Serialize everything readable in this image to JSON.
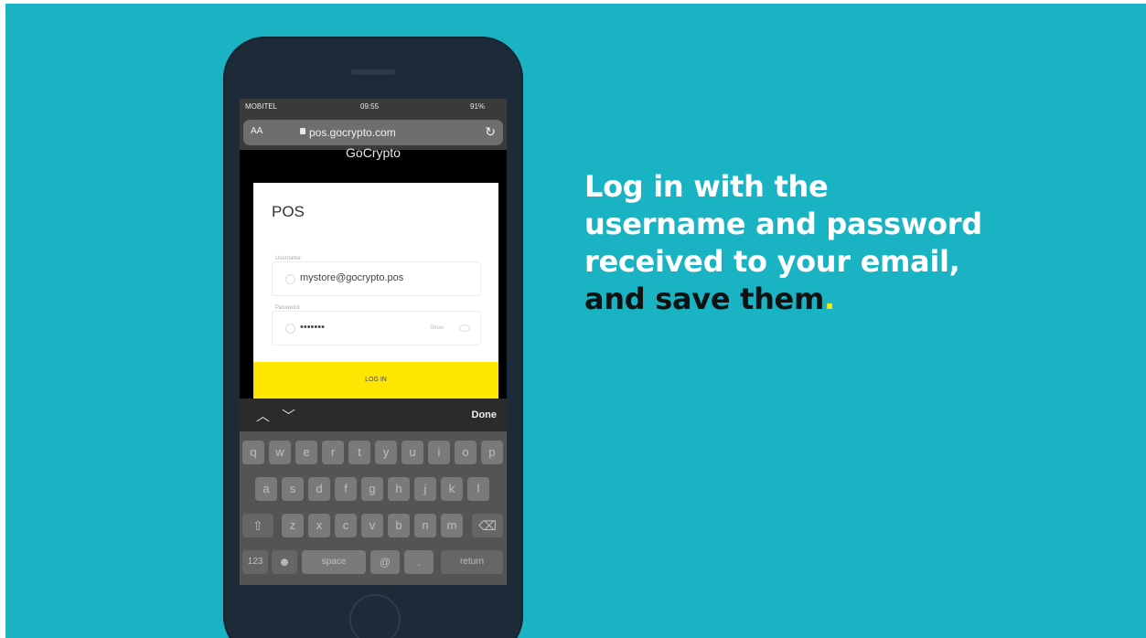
{
  "status_bar": {
    "carrier": "MOBITEL",
    "time": "09:55",
    "battery": "91%"
  },
  "browser": {
    "text_size": "AA",
    "url": "pos.gocrypto.com",
    "reload_icon": "reload-icon"
  },
  "app": {
    "brand": "GoCrypto",
    "card_title": "POS",
    "username": {
      "label": "Username",
      "value": "mystore@gocrypto.pos"
    },
    "password": {
      "label": "Password",
      "value": "•••••••",
      "show_label": "Show"
    },
    "login_label": "LOG IN"
  },
  "keyboard": {
    "toolbar": {
      "done": "Done"
    },
    "row1": [
      "q",
      "w",
      "e",
      "r",
      "t",
      "y",
      "u",
      "i",
      "o",
      "p"
    ],
    "row2": [
      "a",
      "s",
      "d",
      "f",
      "g",
      "h",
      "j",
      "k",
      "l"
    ],
    "row3": [
      "z",
      "x",
      "c",
      "v",
      "b",
      "n",
      "m"
    ],
    "numbers": "123",
    "space": "space",
    "at": "@",
    "dot": ".",
    "return": "return"
  },
  "headline": {
    "line1": "Log in with the",
    "line2": "username and password",
    "line3": "received to your email,",
    "line4": "and save them",
    "period": "."
  },
  "colors": {
    "background": "#1ab3c4",
    "accent": "#ffe600",
    "phone": "#1d2a38"
  }
}
